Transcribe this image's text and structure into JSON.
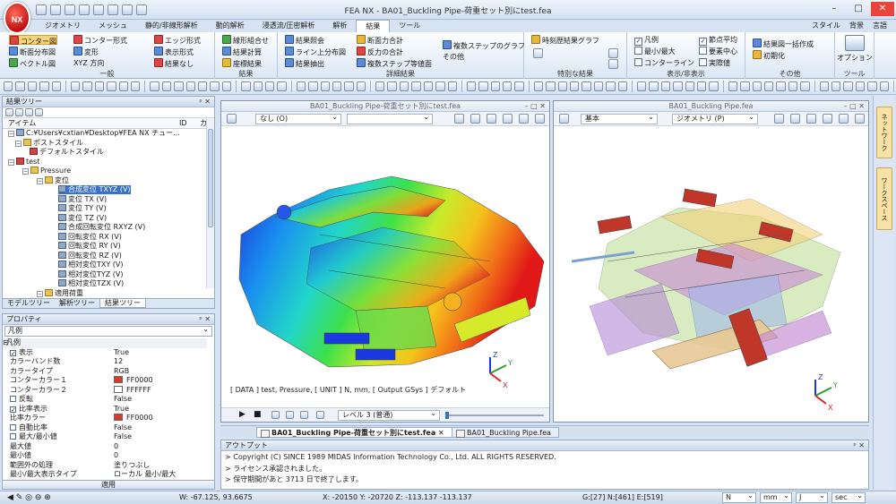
{
  "window": {
    "title": "FEA NX - BA01_Buckling Pipe-荷重セット別にtest.fea",
    "logo": "NX"
  },
  "tabs": [
    "ジオメトリ",
    "メッシュ",
    "静的/非線形解析",
    "動的解析",
    "浸透流/圧密解析",
    "解析",
    "結果",
    "ツール"
  ],
  "active_tab": "結果",
  "top_right": [
    "スタイル",
    "背景",
    "言語"
  ],
  "ribbon": {
    "general": {
      "label": "一般",
      "b1": "コンター図",
      "b2": "断面分布図",
      "b3": "ベクトル図",
      "b4": "コンター形式",
      "b5": "変形",
      "b6": "XYZ 方向",
      "b7": "エッジ形式",
      "b8": "表示形式",
      "b9": "結果なし"
    },
    "result": {
      "label": "結果",
      "b1": "線形組合せ",
      "b2": "結果計算",
      "b3": "座標結果"
    },
    "detail": {
      "label": "詳細結果",
      "b1": "結果照会",
      "b2": "ライン上分布図",
      "b3": "結果抽出",
      "b4": "断面力合計",
      "b5": "反力の合計",
      "b6": "複数ステップ等値面",
      "b7": "複数ステップのグラフ",
      "b8": "その他"
    },
    "special": {
      "label": "特別な結果",
      "b1": "時刻歴結果グラフ"
    },
    "display": {
      "label": "表示/非表示",
      "c1": "凡例",
      "c2": "最小/最大",
      "c3": "コンターライン",
      "c4": "節点平均",
      "c5": "要素中心",
      "c6": "実際値"
    },
    "other": {
      "label": "その他",
      "b1": "結果図一括作成",
      "b2": "初期化"
    },
    "tools": {
      "label": "ツール",
      "b1": "オプション"
    }
  },
  "tree": {
    "title": "結果ツリー",
    "cols": [
      "アイテム",
      "ID",
      "カラ"
    ],
    "nodes": [
      "C:¥Users¥cxtian¥Desktop¥FEA NX チュー...",
      "ポストスタイル",
      "デフォルトスタイル",
      "test",
      "Pressure",
      "変位",
      "合成変位 TXYZ (V)",
      "変位 TX (V)",
      "変位 TY (V)",
      "変位 TZ (V)",
      "合成回転変位 RXYZ (V)",
      "回転変位 RX (V)",
      "回転変位 RY (V)",
      "回転変位 RZ (V)",
      "相対変位TXY (V)",
      "相対変位TYZ (V)",
      "相対変位TZX (V)",
      "適用荷重"
    ]
  },
  "left_tabs": [
    "モデルツリー",
    "解析ツリー",
    "結果ツリー"
  ],
  "props": {
    "title": "プロパティ",
    "selector": "凡例",
    "category": "凡例",
    "rows": [
      {
        "k": "表示",
        "v": "True",
        "check": true
      },
      {
        "k": "カラーバンド数",
        "v": "12"
      },
      {
        "k": "カラータイプ",
        "v": "RGB"
      },
      {
        "k": "コンターカラー１",
        "v": "FF0000",
        "color": "#d93a2b"
      },
      {
        "k": "コンターカラー２",
        "v": "FFFFFF",
        "color": "#ffffff"
      },
      {
        "k": "反転",
        "v": "False",
        "check": false
      },
      {
        "k": "比率表示",
        "v": "True",
        "check": true
      },
      {
        "k": "比率カラー",
        "v": "FF0000",
        "color": "#d93a2b"
      },
      {
        "k": "自動比率",
        "v": "False",
        "check": false
      },
      {
        "k": "最大/最小値",
        "v": "False",
        "check": false
      },
      {
        "k": "最大値",
        "v": "0"
      },
      {
        "k": "最小値",
        "v": "0"
      },
      {
        "k": "範囲外の処理",
        "v": "塗りつぶし"
      },
      {
        "k": "最小/最大表示タイプ",
        "v": "ローカル 最小/最大"
      }
    ],
    "apply": "適用"
  },
  "vp1": {
    "title": "BA01_Buckling Pipe-荷重セット別にtest.fea",
    "dd1": "なし (O)",
    "dd2": "",
    "info": "[ DATA ] test, Pressure, [ UNIT ]  N, mm, [ Output GSys ] デフォルト",
    "level": "レベル 3 (普通)"
  },
  "vp2": {
    "title": "BA01_Buckling Pipe.fea",
    "dd1": "基本",
    "dd2": "ジオメトリ (P)"
  },
  "doctabs": [
    "BA01_Buckling Pipe-荷重セット別にtest.fea",
    "BA01_Buckling Pipe.fea"
  ],
  "output": {
    "title": "アウトプット",
    "lines": [
      "> Copyright (C) SINCE 1989 MIDAS Information Technology Co., Ltd. ALL RIGHTS RESERVED.",
      "> ライセンス承認されました。",
      "> 保守期間があと 3713 日で終了します。"
    ]
  },
  "rdock": [
    "ネットワーク",
    "ワークスペース"
  ],
  "status": {
    "w": "W: -67.125, 93.6675",
    "xyz": "X: -20150 Y: -20720 Z: -113.137 -113.137",
    "g": "G:[27] N:[461] E:[519]",
    "u1": "N",
    "u2": "mm",
    "u3": "J",
    "u4": "sec"
  },
  "axis": {
    "x": "X",
    "y": "Y",
    "z": "Z"
  },
  "colors": {
    "accent": "#3672c9",
    "ribbon_sel": "#fbd57a",
    "close": "#e8453c"
  }
}
